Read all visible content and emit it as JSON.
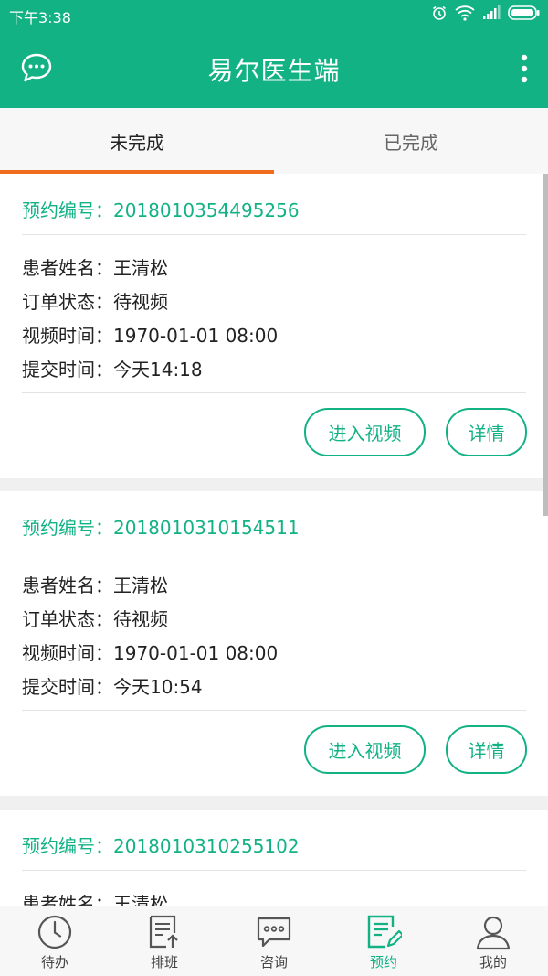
{
  "status_bar": {
    "time": "下午3:38"
  },
  "app_bar": {
    "title": "易尔医生端"
  },
  "tabs": [
    {
      "label": "未完成"
    },
    {
      "label": "已完成"
    }
  ],
  "orders": [
    {
      "order_no": "预约编号：2018010354495256",
      "patient": "患者姓名：王清松",
      "status": "订单状态：待视频",
      "video_time": "视频时间：1970-01-01 08:00",
      "submit_time": "提交时间：今天14:18",
      "video_button": "进入视频",
      "detail_button": "详情"
    },
    {
      "order_no": "预约编号：2018010310154511",
      "patient": "患者姓名：王清松",
      "status": "订单状态：待视频",
      "video_time": "视频时间：1970-01-01 08:00",
      "submit_time": "提交时间：今天10:54",
      "video_button": "进入视频",
      "detail_button": "详情"
    },
    {
      "order_no": "预约编号：2018010310255102",
      "patient": "患者姓名：王清松"
    }
  ],
  "bottom_nav": [
    {
      "label": "待办",
      "icon": "clock-icon"
    },
    {
      "label": "排班",
      "icon": "schedule-upload-icon"
    },
    {
      "label": "咨询",
      "icon": "chat-bubble-icon"
    },
    {
      "label": "预约",
      "icon": "edit-document-icon"
    },
    {
      "label": "我的",
      "icon": "person-icon"
    }
  ],
  "colors": {
    "primary": "#13b285",
    "tab_indicator": "#f06d1e"
  }
}
